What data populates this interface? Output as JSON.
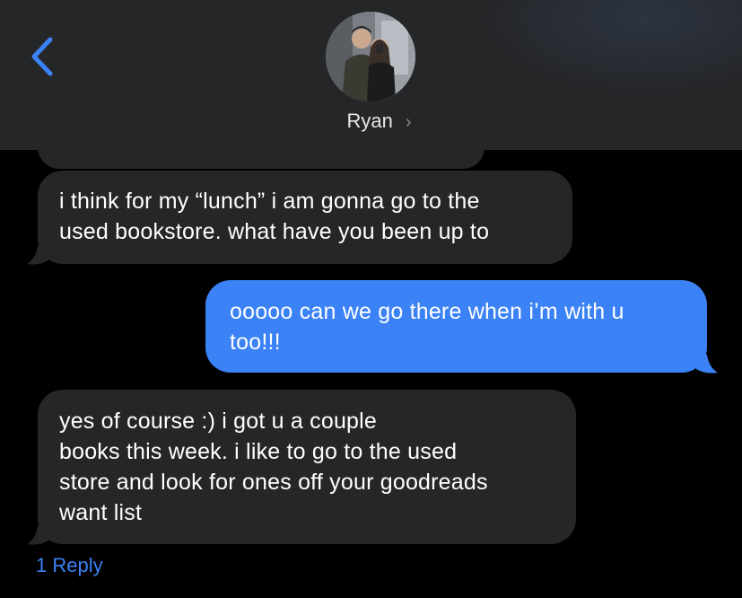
{
  "header": {
    "back_icon": "chevron-left-icon",
    "contact_name": "Ryan",
    "chevron": "›",
    "accent_color": "#3b82f6"
  },
  "messages": [
    {
      "direction": "incoming",
      "lines": [
        "i think for my “lunch” i am gonna go to the",
        "used bookstore. what have you been up to"
      ]
    },
    {
      "direction": "outgoing",
      "lines": [
        "ooooo can we go there when i’m with u",
        "too!!!"
      ]
    },
    {
      "direction": "incoming",
      "lines": [
        "yes of course :) i got u a couple",
        "books this week. i like to go to the used",
        "store and look for ones off your goodreads",
        "want list"
      ]
    }
  ],
  "reply_link": "1 Reply"
}
